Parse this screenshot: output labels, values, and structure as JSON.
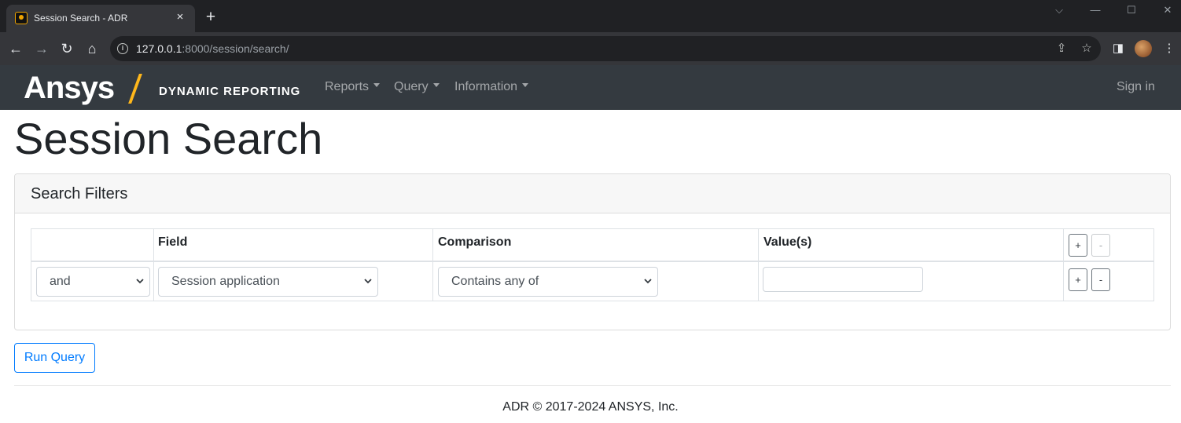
{
  "browser": {
    "tab_title": "Session Search - ADR",
    "tab_close_icon": "×",
    "new_tab_icon": "+",
    "url_host": "127.0.0.1",
    "url_rest": ":8000/session/search/",
    "window_controls": {
      "dropdown": "⌵",
      "minimize": "—",
      "maximize": "☐",
      "close": "✕"
    },
    "nav_icons": {
      "back": "←",
      "forward": "→",
      "reload": "↻",
      "home": "⌂"
    },
    "omnibox_icons": {
      "info": "i",
      "share": "⇪",
      "bookmark": "☆"
    },
    "toolbar_icons": {
      "side_panel": "◨",
      "menu": "⋮"
    }
  },
  "navbar": {
    "brand": "Ansys",
    "brand_sub": "DYNAMIC REPORTING",
    "menu": [
      {
        "label": "Reports"
      },
      {
        "label": "Query"
      },
      {
        "label": "Information"
      }
    ],
    "sign_in": "Sign in"
  },
  "page": {
    "title": "Session Search"
  },
  "filters": {
    "header": "Search Filters",
    "columns": [
      "",
      "Field",
      "Comparison",
      "Value(s)"
    ],
    "header_buttons": {
      "add": "+",
      "remove": "-"
    },
    "rows": [
      {
        "logic": "and",
        "field": "Session application",
        "comparison": "Contains any of",
        "value": "",
        "add": "+",
        "remove": "-"
      }
    ]
  },
  "actions": {
    "run_query": "Run Query"
  },
  "footer": {
    "text": "ADR © 2017-2024 ANSYS, Inc."
  },
  "colors": {
    "navbar_bg": "#343a40",
    "accent": "#ffb71b",
    "primary": "#007bff"
  }
}
